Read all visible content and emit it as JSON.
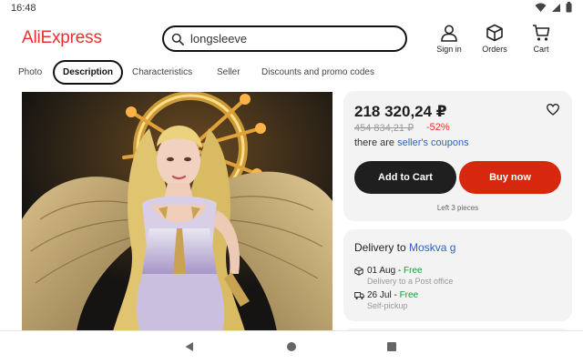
{
  "status_bar": {
    "time": "16:48",
    "icons": [
      "wifi-icon",
      "signal-icon",
      "battery-icon"
    ]
  },
  "header": {
    "logo": "AliExpress",
    "search": {
      "value": "longsleeve",
      "icon": "search-icon"
    },
    "actions": [
      {
        "label": "Sign in",
        "icon": "person-icon"
      },
      {
        "label": "Orders",
        "icon": "box-icon"
      },
      {
        "label": "Cart",
        "icon": "cart-icon"
      }
    ]
  },
  "tabs": [
    {
      "label": "Photo",
      "active": false
    },
    {
      "label": "Description",
      "active": true
    },
    {
      "label": "Characteristics",
      "active": false
    },
    {
      "label": "Seller",
      "active": false
    },
    {
      "label": "Discounts and promo codes",
      "active": false
    }
  ],
  "product_image": {
    "description_icon": "product-photo"
  },
  "price_card": {
    "price": "218 320,24 ₽",
    "old_price": "454 834,21 ₽",
    "discount": "-52%",
    "coupons_prefix": "there are ",
    "coupons_link": "seller's coupons",
    "add_to_cart": "Add to Cart",
    "buy_now": "Buy now",
    "stock": "Left 3 pieces",
    "wishlist_icon": "heart-icon"
  },
  "delivery": {
    "prefix": "Delivery to ",
    "location": "Moskva g",
    "options": [
      {
        "date": "01 Aug",
        "price": "Free",
        "note": "Delivery to a Post office",
        "icon": "box-icon"
      },
      {
        "date": "26 Jul",
        "price": "Free",
        "note": "Self-pickup",
        "icon": "truck-icon"
      }
    ]
  },
  "nav_bar": {
    "buttons": [
      "back-icon",
      "home-icon",
      "recents-icon"
    ]
  },
  "colors": {
    "brand": "#e8322f",
    "buy": "#d8270f",
    "cart": "#1f1f1f",
    "link": "#2b63c6",
    "free": "#0f9d3a"
  }
}
